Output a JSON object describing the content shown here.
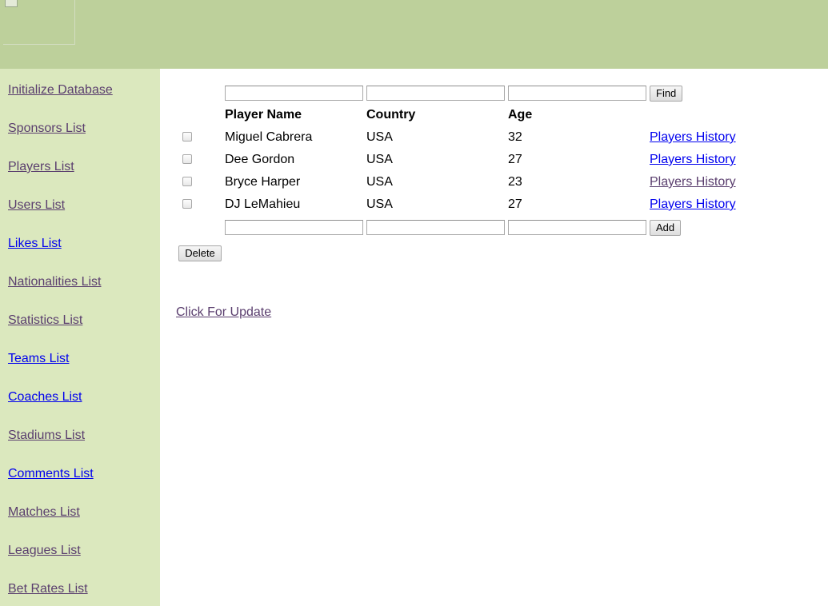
{
  "colors": {
    "header_bg": "#bdd09b",
    "sidebar_bg": "#dbe8be",
    "visited_link": "#5a3e6e",
    "unvisited_link": "#0000ee"
  },
  "header": {
    "logo_icon": "broken-image-icon"
  },
  "sidebar": {
    "items": [
      {
        "label": "Initialize Database",
        "visited": true
      },
      {
        "label": "Sponsors List",
        "visited": true
      },
      {
        "label": "Players List",
        "visited": true
      },
      {
        "label": "Users List",
        "visited": true
      },
      {
        "label": "Likes List",
        "visited": false
      },
      {
        "label": "Nationalities List",
        "visited": true
      },
      {
        "label": "Statistics List",
        "visited": true
      },
      {
        "label": "Teams List",
        "visited": false
      },
      {
        "label": "Coaches List",
        "visited": false
      },
      {
        "label": "Stadiums List",
        "visited": true
      },
      {
        "label": "Comments List",
        "visited": false
      },
      {
        "label": "Matches List",
        "visited": true
      },
      {
        "label": "Leagues List",
        "visited": true
      },
      {
        "label": "Bet Rates List",
        "visited": true
      }
    ]
  },
  "search": {
    "name_value": "",
    "country_value": "",
    "age_value": "",
    "find_label": "Find"
  },
  "table": {
    "headers": [
      "Player Name",
      "Country",
      "Age"
    ],
    "rows": [
      {
        "name": "Miguel Cabrera",
        "country": "USA",
        "age": "32",
        "link": "Players History",
        "link_visited": false,
        "checked": false
      },
      {
        "name": "Dee Gordon",
        "country": "USA",
        "age": "27",
        "link": "Players History",
        "link_visited": false,
        "checked": false
      },
      {
        "name": "Bryce Harper",
        "country": "USA",
        "age": "23",
        "link": "Players History",
        "link_visited": true,
        "checked": false
      },
      {
        "name": "DJ LeMahieu",
        "country": "USA",
        "age": "27",
        "link": "Players History",
        "link_visited": false,
        "checked": false
      }
    ]
  },
  "add_form": {
    "name_value": "",
    "country_value": "",
    "age_value": "",
    "add_label": "Add"
  },
  "delete_label": "Delete",
  "update_link": {
    "label": "Click For Update",
    "visited": true
  }
}
